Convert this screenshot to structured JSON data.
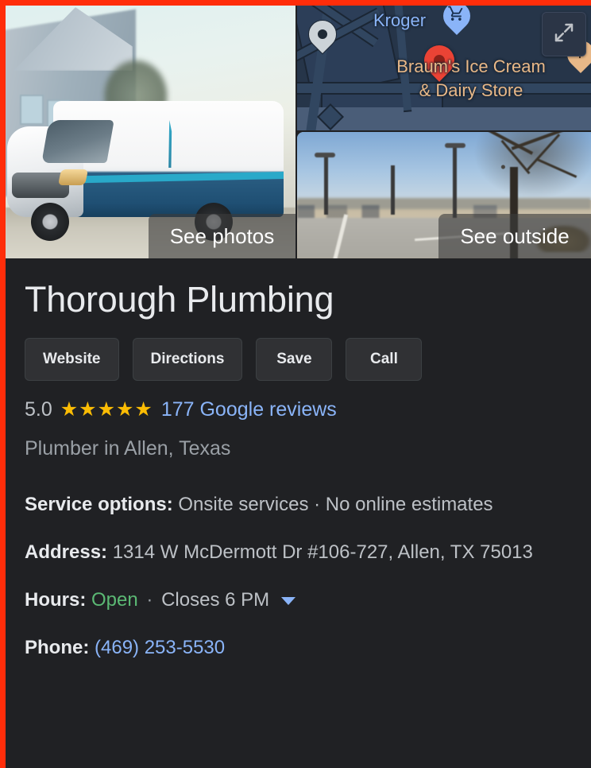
{
  "frame": {
    "highlight_color": "#ff2d0a",
    "panel_background": "#202124"
  },
  "media": {
    "photo_caption": "See photos",
    "street_caption": "See outside",
    "photo_alt": "plumbing-service-van",
    "map": {
      "expand_icon": "expand-arrows-icon",
      "labels": [
        {
          "name": "Kroger",
          "color": "#8ab4f8",
          "icon": "shopping-cart-icon"
        },
        {
          "name": "Braum's Ice Cream & Dairy Store",
          "line1": "Braum's Ice Cream",
          "line2": "& Dairy Store",
          "color": "#e8b888",
          "icon": "restaurant-fork-icon"
        }
      ],
      "markers": [
        {
          "type": "place-marker-gray",
          "color": "#ccd3d8"
        },
        {
          "type": "business-marker-red",
          "color": "#ea4335"
        },
        {
          "type": "grocery-marker-blue",
          "color": "#8ab4f8"
        },
        {
          "type": "restaurant-marker-tan",
          "color": "#e8b888"
        }
      ]
    }
  },
  "business": {
    "name": "Thorough Plumbing",
    "rating": "5.0",
    "stars": "★★★★★",
    "star_color": "#fbbc04",
    "reviews": "177 Google reviews",
    "category": "Plumber in Allen, Texas"
  },
  "actions": [
    {
      "label": "Website",
      "name": "website-button"
    },
    {
      "label": "Directions",
      "name": "directions-button"
    },
    {
      "label": "Save",
      "name": "save-button"
    },
    {
      "label": "Call",
      "name": "call-button"
    }
  ],
  "facts": {
    "service_options": {
      "label": "Service options:",
      "value": "Onsite services · No online estimates"
    },
    "address": {
      "label": "Address:",
      "value": "1314 W McDermott Dr #106-727, Allen, TX 75013"
    },
    "hours": {
      "label": "Hours:",
      "status": "Open",
      "separator": "·",
      "closes": "Closes 6 PM",
      "status_color": "#5bb974"
    },
    "phone": {
      "label": "Phone:",
      "value": "(469) 253-5530",
      "link_color": "#8ab4f8"
    }
  }
}
